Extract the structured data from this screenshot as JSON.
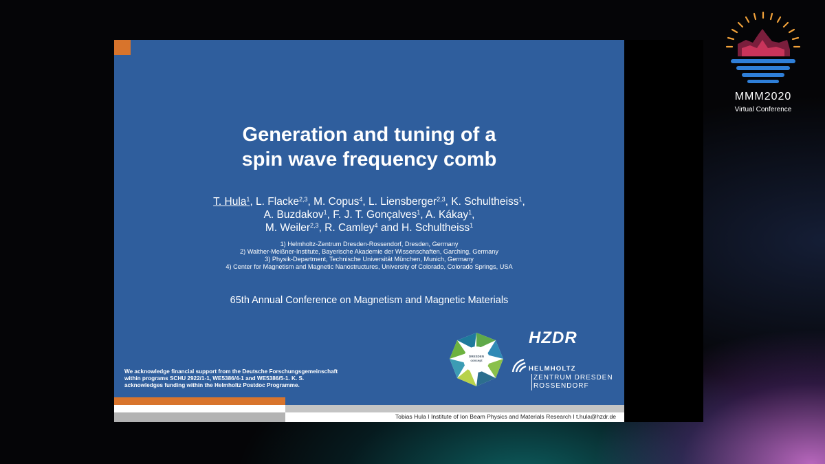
{
  "slide": {
    "title_line1": "Generation and tuning of a",
    "title_line2": "spin wave frequency comb",
    "authors": {
      "a1": "T. Hula",
      "a1_sup": "1",
      "a2": ", L. Flacke",
      "a2_sup": "2,3",
      "a3": ", M. Copus",
      "a3_sup": "4",
      "a4": ", L. Liensberger",
      "a4_sup": "2,3",
      "a5": ", K. Schultheiss",
      "a5_sup": "1",
      "a5_tail": ",",
      "a6": "A. Buzdakov",
      "a6_sup": "1",
      "a7": ", F. J. T. Gonçalves",
      "a7_sup": "1",
      "a8": ", A. Kákay",
      "a8_sup": "1",
      "a8_tail": ",",
      "a9": "M. Weiler",
      "a9_sup": "2,3",
      "a10": ", R. Camley",
      "a10_sup": "4",
      "a11": " and H. Schultheiss",
      "a11_sup": "1"
    },
    "affiliations": [
      "1) Helmholtz-Zentrum Dresden-Rossendorf, Dresden, Germany",
      "2) Walther-Meißner-Institute, Bayerische Akademie der Wissenschaften, Garching, Germany",
      "3) Physik-Department, Technische Universität München, Munich, Germany",
      "4) Center for Magnetism and Magnetic Nanostructures, University of Colorado, Colorado Springs, USA"
    ],
    "conference": "65th Annual Conference on Magnetism and Magnetic Materials",
    "acknowledgement": [
      "We acknowledge financial support from the Deutsche Forschungsgemeinschaft",
      "within programs SCHU 2922/1-1, WE5386/4-1 and WE5386/5-1. K. S.",
      "acknowledges funding within the Helmholtz Postdoc Programme."
    ],
    "footer": "Tobias Hula I  Institute of Ion Beam Physics and Materials Research  I  t.hula@hzdr.de",
    "logos": {
      "dresden_line1": "DRESDEN",
      "dresden_line2": "concept",
      "hzdr": "HZDR",
      "helmholtz": "HELMHOLTZ",
      "zentrum_line1": "ZENTRUM DRESDEN",
      "zentrum_line2": "ROSSENDORF"
    },
    "colors": {
      "background": "#2f5e9d",
      "accent": "#d8742c"
    }
  },
  "conference_badge": {
    "title": "MMM2020",
    "subtitle": "Virtual Conference"
  }
}
